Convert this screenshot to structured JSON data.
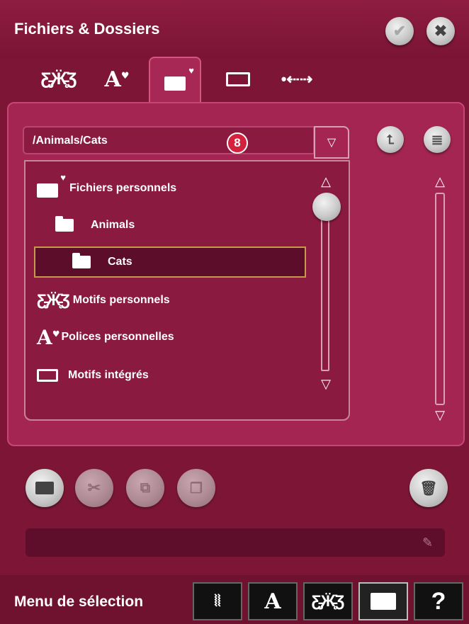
{
  "window": {
    "title": "Fichiers & Dossiers",
    "ok_icon": "checkmark-icon",
    "close_icon": "close-icon"
  },
  "tabs": [
    {
      "name": "embroidery-motifs",
      "icon": "butterfly-heart-icon"
    },
    {
      "name": "fonts",
      "icon": "letter-a-heart-icon"
    },
    {
      "name": "files",
      "icon": "folder-heart-icon",
      "selected": true
    },
    {
      "name": "sewing-machine",
      "icon": "sewing-machine-icon"
    },
    {
      "name": "usb",
      "icon": "usb-icon"
    }
  ],
  "path": {
    "value": "/Animals/Cats",
    "marker": "8"
  },
  "files": [
    {
      "label": "Fichiers personnels",
      "icon": "folder-heart-icon",
      "level": 0
    },
    {
      "label": "Animals",
      "icon": "folder-icon",
      "level": 1
    },
    {
      "label": "Cats",
      "icon": "folder-icon",
      "level": 2,
      "selected": true
    },
    {
      "label": "Motifs personnels",
      "icon": "butterfly-heart-icon",
      "level": 0
    },
    {
      "label": "Polices personnelles",
      "icon": "letter-a-heart-icon",
      "level": 0
    },
    {
      "label": "Motifs intégrés",
      "icon": "sewing-machine-icon",
      "level": 0
    }
  ],
  "toolbar": [
    "new-folder-icon",
    "cut-icon",
    "copy-icon",
    "paste-icon",
    "trash-icon"
  ],
  "bottom": {
    "menu_label": "Menu de sélection",
    "buttons": [
      "stitch-icon",
      "letter-a-icon",
      "butterfly-icon",
      "open-folder-icon",
      "help-icon"
    ],
    "help_text": "?",
    "letter_text": "A"
  },
  "colors": {
    "background": "#7d1636",
    "panel": "#a42551",
    "list": "#8b1a41",
    "selected": "#5c0d2a",
    "marker": "#d4213d"
  }
}
